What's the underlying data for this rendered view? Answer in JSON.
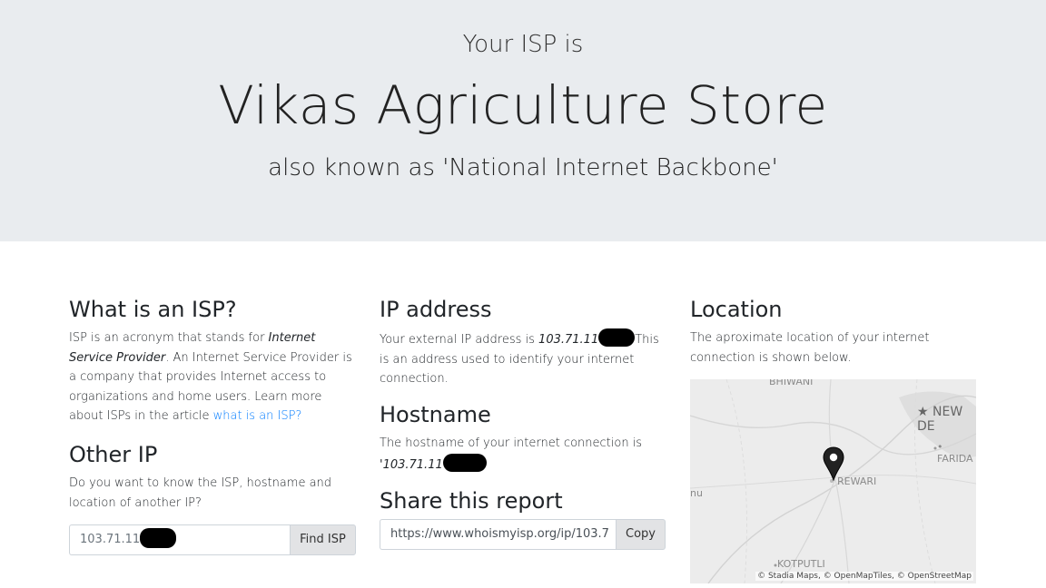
{
  "hero": {
    "pre": "Your ISP is",
    "isp_name": "Vikas Agriculture Store",
    "aka": "also known as 'National Internet Backbone'"
  },
  "what_isp": {
    "heading": "What is an ISP?",
    "text_1": "ISP is an acronym that stands for ",
    "text_em": "Internet Service Provider",
    "text_2": ". An Internet Service Provider is a company that provides Internet access to organizations and home users. Learn more about ISPs in the article ",
    "link": "what is an ISP?"
  },
  "other_ip": {
    "heading": "Other IP",
    "text": "Do you want to know the ISP, hostname and location of another IP?",
    "input_value": "103.71.11",
    "button": "Find ISP"
  },
  "ip_address": {
    "heading": "IP address",
    "text_1": "Your external IP address is ",
    "ip": "103.71.11",
    "text_2": "This is an address used to identify your internet connection."
  },
  "hostname": {
    "heading": "Hostname",
    "text": "The hostname of your internet connection is",
    "value": "'103.71.11"
  },
  "share": {
    "heading": "Share this report",
    "url": "https://www.whoismyisp.org/ip/103.7",
    "button": "Copy"
  },
  "location": {
    "heading": "Location",
    "text": "The aproximate location of your internet connection is shown below.",
    "map_labels": {
      "bhiwani": "BHIWANI",
      "new_delhi": "NEW DE",
      "faridabad": "FARIDA",
      "rewari": "REWARI",
      "nu": "nu",
      "kotputli": "KOTPUTLI"
    },
    "attribution": "© Stadia Maps, © OpenMapTiles, © OpenStreetMap"
  }
}
